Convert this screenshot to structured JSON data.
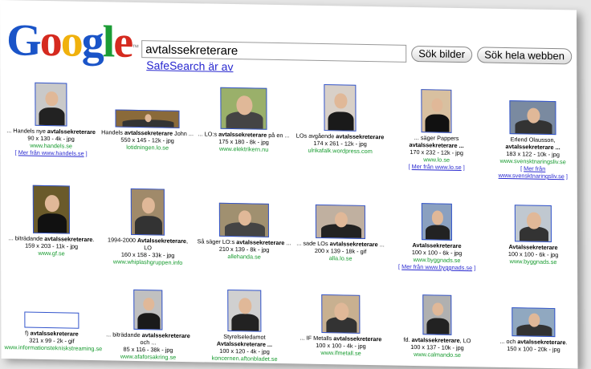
{
  "logo_text": "Google",
  "logo_tm": "™",
  "search": {
    "value": "avtalssekreterare"
  },
  "buttons": {
    "images": "Sök bilder",
    "web": "Sök hela webben"
  },
  "safesearch": "SafeSearch är av",
  "rows": [
    [
      {
        "pre": "... Handels nye ",
        "bold": "avtalssekreterare",
        "post": "",
        "meta": "90 x 130 - 4k - jpg",
        "src": "www.handels.se",
        "more": "Mer från www.handels.se",
        "line2": ""
      },
      {
        "pre": "Handels ",
        "bold": "avtalssekreterare",
        "post": " John ...",
        "meta": "550 x 145 - 12k - jpg",
        "src": "lotidningen.lo.se",
        "more": "",
        "line2": ""
      },
      {
        "pre": "... LO:s ",
        "bold": "avtalssekreterare",
        "post": " på en ...",
        "meta": "175 x 180 - 8k - jpg",
        "src": "www.elektrikern.nu",
        "more": "",
        "line2": ""
      },
      {
        "pre": "LOs avgående ",
        "bold": "avtalssekreterare",
        "post": "",
        "meta": "174 x 261 - 12k - jpg",
        "src": "ulrikafalk.wordpress.com",
        "more": "",
        "line2": ""
      },
      {
        "pre": "... säger Pappers",
        "bold": "avtalssekreterare ...",
        "post": "",
        "meta": "170 x 232 - 12k - jpg",
        "src": "www.lo.se",
        "more": "Mer från www.lo.se",
        "line2": ""
      },
      {
        "pre": "Erlend Olausson,",
        "bold": "avtalssekreterare ...",
        "post": "",
        "meta": "183 x 122 - 10k - jpg",
        "src": "www.svensktnaringsliv.se",
        "more": "Mer från",
        "line2": ""
      }
    ],
    [
      {
        "pre": "... biträdande ",
        "bold": "avtalssekreterare",
        "post": ".",
        "meta": "159 x 203 - 11k - jpg",
        "src": "www.gf.se",
        "more": "",
        "line2": ""
      },
      {
        "pre": "1994-2000 ",
        "bold": "Avtalssekreterare",
        "post": ",",
        "meta": "160 x 158 - 33k - jpg",
        "src": "www.whiplashgruppen.info",
        "more": "",
        "line2": "LO"
      },
      {
        "pre": "Så säger LO:s ",
        "bold": "avtalssekreterare",
        "post": " ...",
        "meta": "210 x 139 - 8k - jpg",
        "src": "allehanda.se",
        "more": "",
        "line2": ""
      },
      {
        "pre": "... sade LOs ",
        "bold": "avtalssekreterare",
        "post": " ...",
        "meta": "200 x 139 - 18k - gif",
        "src": "alla.lo.se",
        "more": "",
        "line2": ""
      },
      {
        "pre": "",
        "bold": "Avtalssekreterare",
        "post": "",
        "meta": "100 x 100 - 6k - jpg",
        "src": "www.byggnads.se",
        "more": "Mer från www.byggnads.se",
        "line2": ""
      },
      {
        "pre": "",
        "bold": "Avtalssekreterare",
        "post": "",
        "meta": "100 x 100 - 6k - jpg",
        "src": "www.byggnads.se",
        "more": "",
        "line2": ""
      }
    ],
    [
      {
        "pre": "f) ",
        "bold": "avtalssekreterare",
        "post": "",
        "meta": "321 x 99 - 2k - gif",
        "src": "www.informationstekniskstreaming.se",
        "more": "",
        "line2": ""
      },
      {
        "pre": "... biträdande ",
        "bold": "avtalssekreterare",
        "post": "",
        "meta": "85 x 116 - 38k - jpg",
        "src": "www.afaforsakring.se",
        "more": "",
        "line2": "och ..."
      },
      {
        "pre": "Styrelseledamot",
        "bold": "Avtalssekreterare ...",
        "post": "",
        "meta": "100 x 120 - 4k - jpg",
        "src": "koncernen.aftonbladet.se",
        "more": "",
        "line2": ""
      },
      {
        "pre": "... IF Metalls ",
        "bold": "avtalssekreterare",
        "post": "",
        "meta": "100 x 100 - 4k - jpg",
        "src": "www.ifmetall.se",
        "more": "",
        "line2": ""
      },
      {
        "pre": "fd. ",
        "bold": "avtalssekreterare",
        "post": ", LO",
        "meta": "100 x 137 - 10k - jpg",
        "src": "www.calmando.se",
        "more": "",
        "line2": ""
      },
      {
        "pre": "... och ",
        "bold": "avtalssekreterare",
        "post": ".",
        "meta": "150 x 100 - 20k - jpg",
        "src": "",
        "more": "",
        "line2": ""
      }
    ]
  ],
  "colors": {
    "link": "#2a2ad0",
    "source": "#179b2f",
    "border": "#3355cc"
  }
}
